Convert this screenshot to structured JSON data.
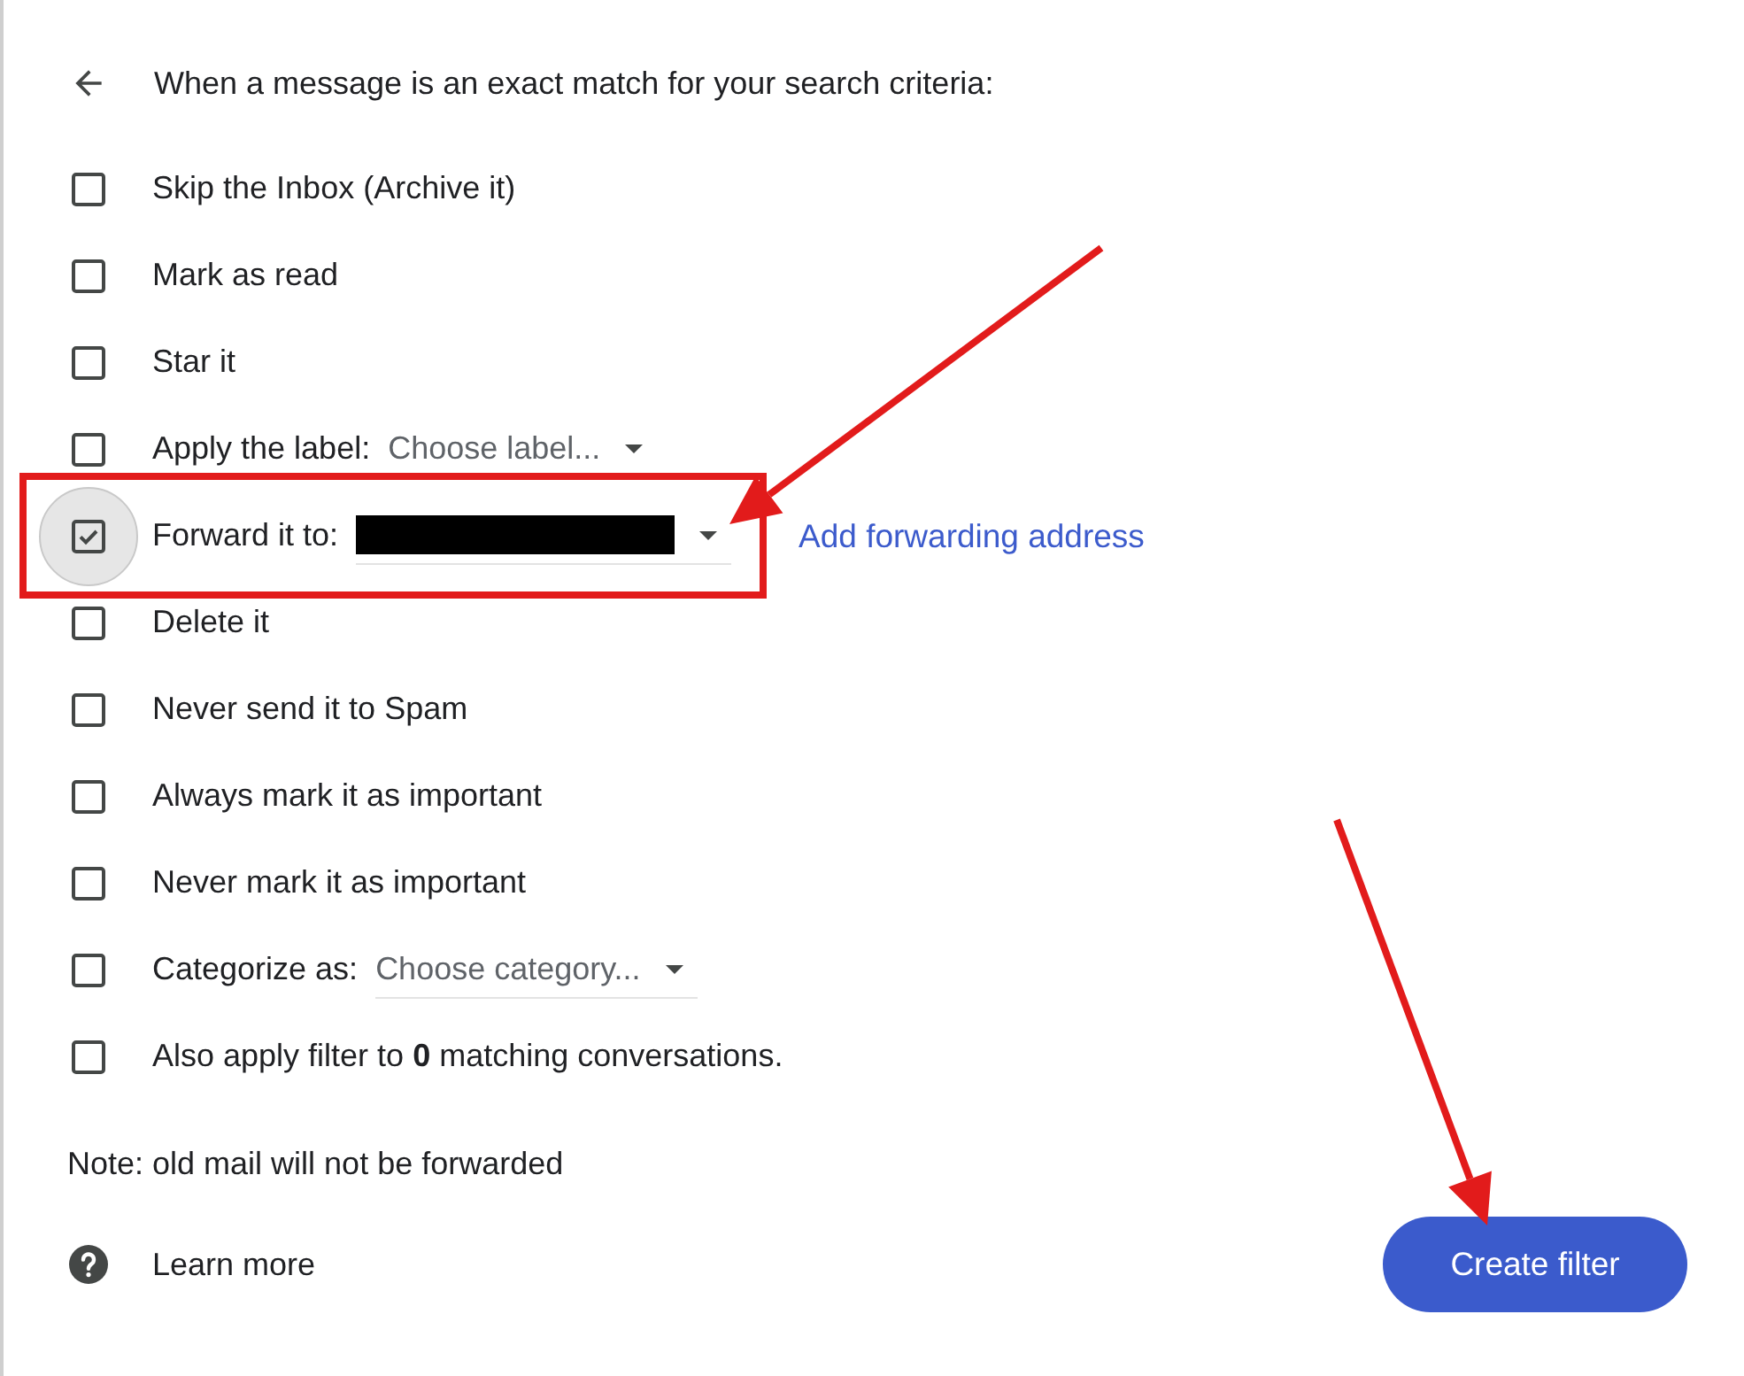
{
  "header": {
    "title": "When a message is an exact match for your search criteria:"
  },
  "actions": [
    {
      "kind": "plain",
      "label": "Skip the Inbox (Archive it)",
      "checked": false,
      "focused": false
    },
    {
      "kind": "plain",
      "label": "Mark as read",
      "checked": false,
      "focused": false
    },
    {
      "kind": "plain",
      "label": "Star it",
      "checked": false,
      "focused": false
    },
    {
      "kind": "select",
      "label": "Apply the label:",
      "placeholder": "Choose label...",
      "checked": false,
      "focused": false
    },
    {
      "kind": "forward",
      "label": "Forward it to:",
      "redacted": true,
      "link": "Add forwarding address",
      "checked": true,
      "focused": true
    },
    {
      "kind": "plain",
      "label": "Delete it",
      "checked": false,
      "focused": false
    },
    {
      "kind": "plain",
      "label": "Never send it to Spam",
      "checked": false,
      "focused": false
    },
    {
      "kind": "plain",
      "label": "Always mark it as important",
      "checked": false,
      "focused": false
    },
    {
      "kind": "plain",
      "label": "Never mark it as important",
      "checked": false,
      "focused": false
    },
    {
      "kind": "select",
      "label": "Categorize as:",
      "placeholder": "Choose category...",
      "checked": false,
      "focused": false
    },
    {
      "kind": "plain",
      "label": "Also apply filter to **0** matching conversations.",
      "checked": false,
      "focused": false
    }
  ],
  "note": "Note: old mail will not be forwarded",
  "footer": {
    "learn_more": "Learn more",
    "create_button": "Create filter"
  },
  "annotations": [
    {
      "kind": "highlight-box",
      "color": "#e21b1b"
    },
    {
      "kind": "arrow",
      "color": "#e21b1b"
    },
    {
      "kind": "arrow",
      "color": "#e21b1b"
    }
  ]
}
